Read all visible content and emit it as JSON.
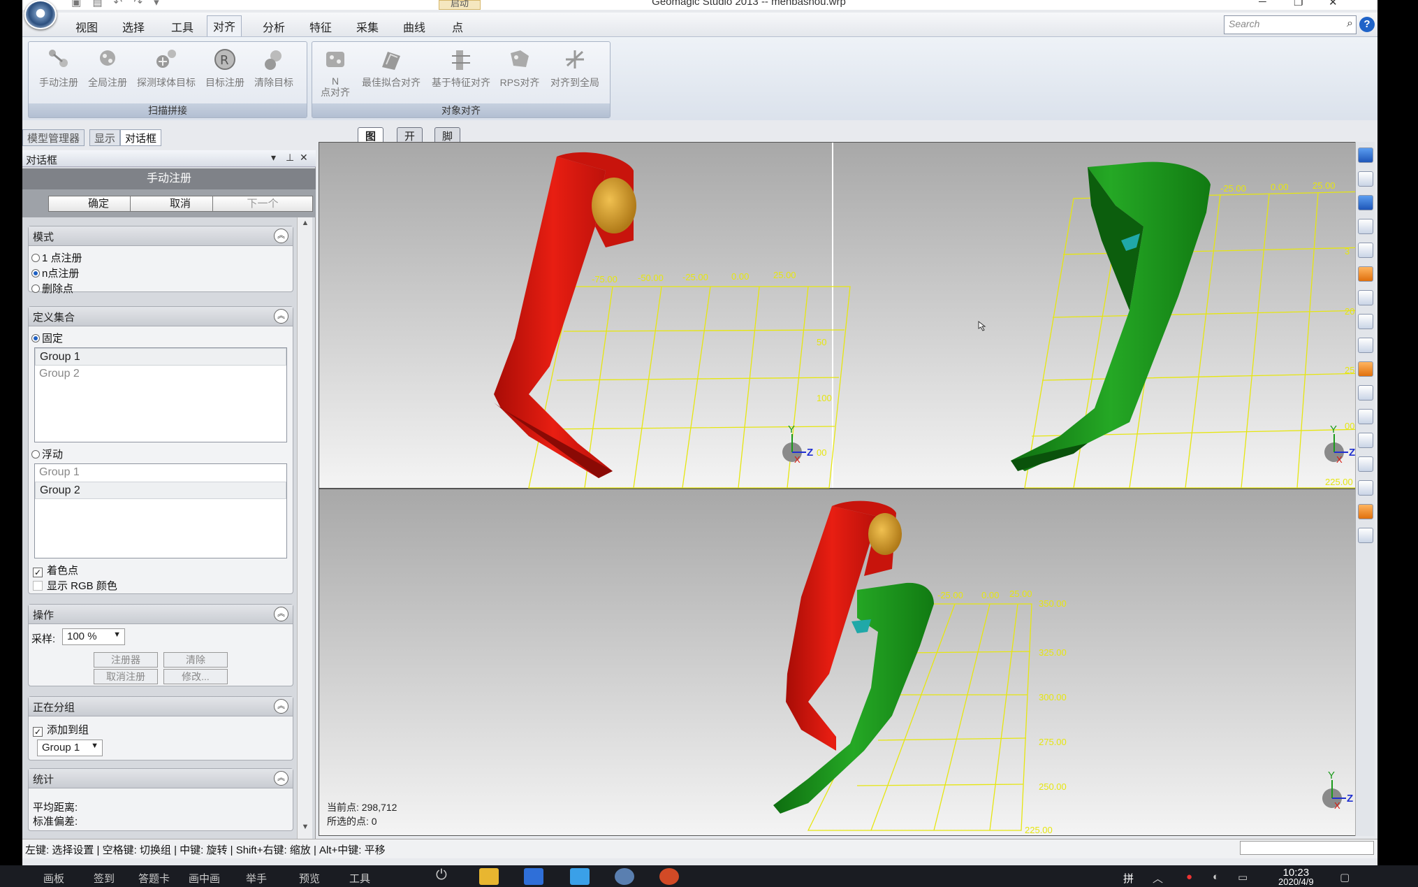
{
  "window": {
    "title": "Geomagic Studio 2013 -- menbashou.wrp",
    "qat_launch": "启动"
  },
  "menu": {
    "tabs": [
      "视图",
      "选择",
      "工具",
      "对齐",
      "分析",
      "特征",
      "采集",
      "曲线",
      "点"
    ],
    "active": 3
  },
  "search": {
    "placeholder": "Search"
  },
  "ribbon": {
    "group1": {
      "label": "扫描拼接",
      "buttons": [
        "手动注册",
        "全局注册",
        "探测球体目标",
        "目标注册",
        "清除目标"
      ]
    },
    "group2": {
      "label": "对象对齐",
      "buttons": [
        "N\n点对齐",
        "最佳拟合对齐",
        "基于特征对齐",
        "RPS对齐",
        "对齐到全局"
      ]
    }
  },
  "dock_tabs": [
    "模型管理器",
    "显示",
    "对话框"
  ],
  "view_tabs": [
    "图形",
    "开始",
    "脚本"
  ],
  "dialog": {
    "title": "对话框",
    "header": "手动注册",
    "ok": "确定",
    "cancel": "取消",
    "next": "下一个",
    "mode": {
      "title": "模式",
      "options": [
        "1 点注册",
        "n点注册",
        "删除点"
      ],
      "selected": 1
    },
    "define": {
      "title": "定义集合",
      "fixed_label": "固定",
      "fixed_groups": [
        "Group 1",
        "Group 2"
      ],
      "float_label": "浮动",
      "float_groups": [
        "Group 1",
        "Group 2"
      ],
      "color_points": "着色点",
      "show_rgb": "显示 RGB 颜色"
    },
    "ops": {
      "title": "操作",
      "sample_label": "采样:",
      "sample_value": "100 %",
      "register": "注册器",
      "clear": "清除",
      "unregister": "取消注册",
      "modify": "修改..."
    },
    "grouping": {
      "title": "正在分组",
      "add_to_group": "添加到组",
      "group_value": "Group 1"
    },
    "stats": {
      "title": "统计",
      "avg": "平均距离:",
      "std": "标准偏差:"
    }
  },
  "viewport": {
    "current_points_label": "当前点:",
    "current_points": "298,712",
    "selected_points_label": "所选的点:",
    "selected_points": "0",
    "grid_labels_1": [
      "-75.00",
      "-50.00",
      "-25.00",
      "0.00",
      "25.00",
      "50",
      "100",
      "00"
    ],
    "grid_labels_2": [
      "-25.00",
      "0.00",
      "25.00",
      "3",
      "200",
      "250",
      "00",
      "225.00"
    ],
    "grid_labels_3": [
      "-25.00",
      "0.00",
      "25.00",
      "350.00",
      "325.00",
      "300.00",
      "275.00",
      "250.00",
      "225.00"
    ],
    "axes": {
      "x": "X",
      "y": "Y",
      "z": "Z"
    },
    "colors": {
      "red": "#d91a10",
      "green": "#1a9a1a",
      "gold": "#d8a02a",
      "grid": "#e6e610"
    }
  },
  "status": {
    "hint": "左键: 选择设置 | 空格键: 切换组 | 中键: 旋转 | Shift+右键: 缩放 | Alt+中键: 平移"
  },
  "taskbar": {
    "items": [
      "画板",
      "签到",
      "答题卡",
      "画中画",
      "举手",
      "预览",
      "工具"
    ],
    "ime": "拼",
    "time": "10:23",
    "date": "2020/4/9"
  }
}
